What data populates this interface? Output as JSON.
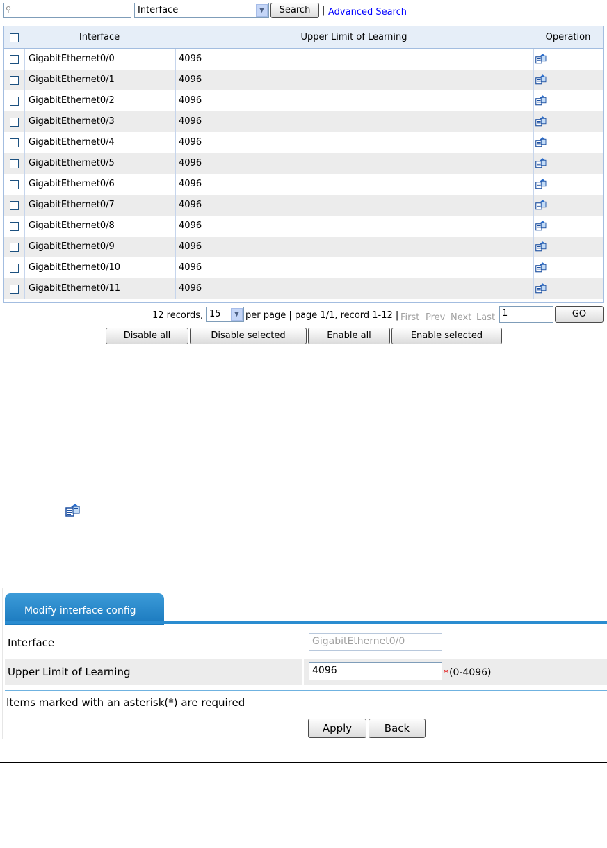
{
  "search": {
    "placeholder": "",
    "field_selected": "Interface",
    "search_label": "Search",
    "separator": "|",
    "advanced_label": "Advanced Search"
  },
  "table": {
    "headers": [
      "Interface",
      "Upper Limit of Learning",
      "Operation"
    ],
    "rows": [
      {
        "interface": "GigabitEthernet0/0",
        "limit": "4096"
      },
      {
        "interface": "GigabitEthernet0/1",
        "limit": "4096"
      },
      {
        "interface": "GigabitEthernet0/2",
        "limit": "4096"
      },
      {
        "interface": "GigabitEthernet0/3",
        "limit": "4096"
      },
      {
        "interface": "GigabitEthernet0/4",
        "limit": "4096"
      },
      {
        "interface": "GigabitEthernet0/5",
        "limit": "4096"
      },
      {
        "interface": "GigabitEthernet0/6",
        "limit": "4096"
      },
      {
        "interface": "GigabitEthernet0/7",
        "limit": "4096"
      },
      {
        "interface": "GigabitEthernet0/8",
        "limit": "4096"
      },
      {
        "interface": "GigabitEthernet0/9",
        "limit": "4096"
      },
      {
        "interface": "GigabitEthernet0/10",
        "limit": "4096"
      },
      {
        "interface": "GigabitEthernet0/11",
        "limit": "4096"
      }
    ],
    "operation_icon": "edit-icon"
  },
  "pager": {
    "records_text": "12 records,",
    "per_page": "15",
    "info_text": "per page | page 1/1, record 1-12 |",
    "first": "First",
    "prev": "Prev",
    "next": "Next",
    "last": "Last",
    "page_input": "1",
    "go_label": "GO"
  },
  "actions": {
    "disable_all": "Disable all",
    "disable_selected": "Disable selected",
    "enable_all": "Enable all",
    "enable_selected": "Enable selected"
  },
  "form": {
    "tab_label": "Modify interface config",
    "interface_label": "Interface",
    "interface_value": "GigabitEthernet0/0",
    "limit_label": "Upper Limit of Learning",
    "limit_value": "4096",
    "required_mark": "*",
    "limit_range": "(0-4096)",
    "note": "Items marked with an asterisk(*) are required",
    "apply_label": "Apply",
    "back_label": "Back"
  },
  "colors": {
    "header_bg": "#e6eef8",
    "row_alt": "#ececec",
    "tab_blue": "#1a79be",
    "link": "#0000ff"
  }
}
